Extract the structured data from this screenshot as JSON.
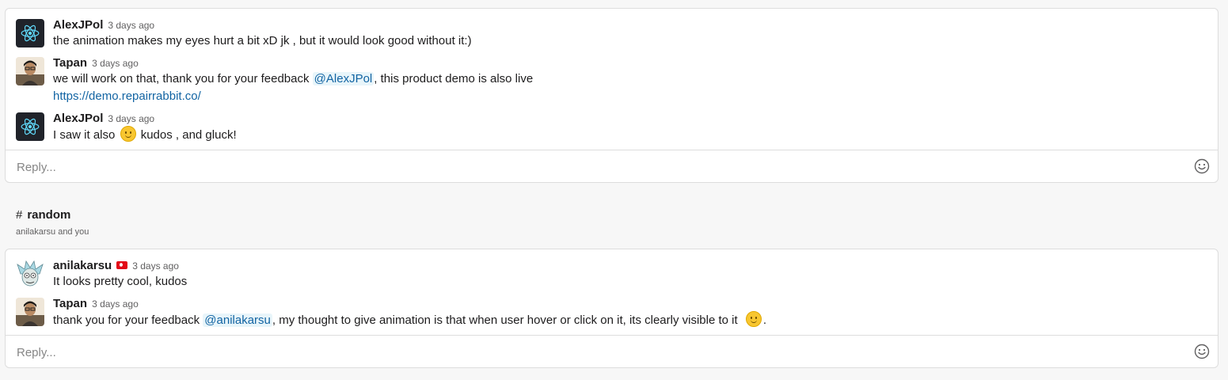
{
  "thread1": {
    "messages": [
      {
        "author": "AlexJPol",
        "time": "3 days ago",
        "text": "the animation makes my eyes hurt a bit xD jk , but it would look good without it:)"
      },
      {
        "author": "Tapan",
        "time": "3 days ago",
        "text_before": "we will work on that, thank you for your feedback ",
        "mention": "@AlexJPol",
        "text_after": ", this product demo is also live",
        "link": "https://demo.repairrabbit.co/"
      },
      {
        "author": "AlexJPol",
        "time": "3 days ago",
        "text_before": "I saw it also ",
        "emoji": "slightly-smiling-face",
        "text_after": " kudos , and gluck!"
      }
    ],
    "reply_placeholder": "Reply..."
  },
  "channel": {
    "hash": "#",
    "name": "random",
    "members": "anilakarsu and you"
  },
  "thread2": {
    "messages": [
      {
        "author": "anilakarsu",
        "flag": "turkey-flag",
        "time": "3 days ago",
        "text": "It looks pretty cool, kudos"
      },
      {
        "author": "Tapan",
        "time": "3 days ago",
        "text_before": "thank you for your feedback ",
        "mention": "@anilakarsu",
        "text_after": ", my thought to give animation is that when user hover or click on it, its clearly visible to it ",
        "emoji": "slightly-smiling-face",
        "text_end": "."
      }
    ],
    "reply_placeholder": "Reply..."
  },
  "colors": {
    "link": "#1264a3",
    "mention_bg": "#e8f5fa",
    "react_bg": "#20232a",
    "react_logo": "#61dafb"
  },
  "icons": {
    "react_avatar": "react-logo-icon",
    "emoji_button": "smile-icon"
  }
}
